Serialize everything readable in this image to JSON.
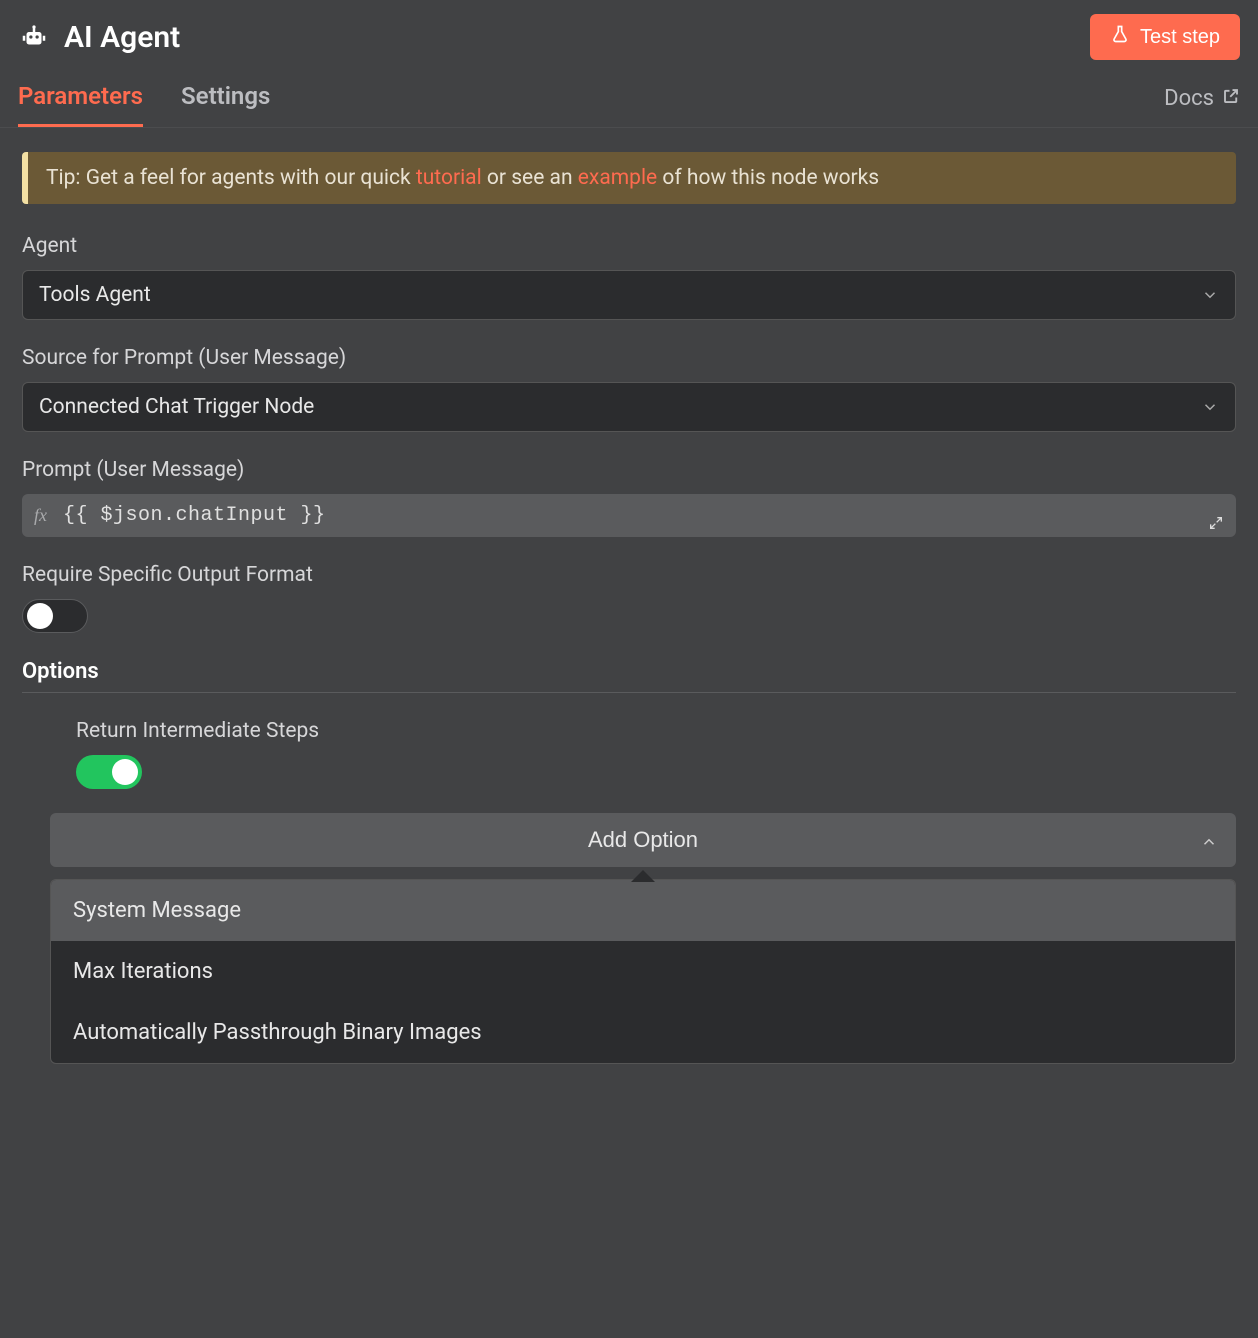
{
  "header": {
    "title": "AI Agent",
    "test_button": "Test step"
  },
  "tabs": {
    "parameters": "Parameters",
    "settings": "Settings",
    "docs": "Docs"
  },
  "tip": {
    "prefix": "Tip: Get a feel for agents with our quick ",
    "link1": "tutorial",
    "mid": " or see an ",
    "link2": "example",
    "suffix": " of how this node works"
  },
  "fields": {
    "agent": {
      "label": "Agent",
      "value": "Tools Agent"
    },
    "source_prompt": {
      "label": "Source for Prompt (User Message)",
      "value": "Connected Chat Trigger Node"
    },
    "prompt": {
      "label": "Prompt (User Message)",
      "value": "{{ $json.chatInput }}"
    },
    "require_format": {
      "label": "Require Specific Output Format"
    }
  },
  "options": {
    "heading": "Options",
    "return_intermediate": {
      "label": "Return Intermediate Steps"
    },
    "add_option": "Add Option",
    "menu": [
      "System Message",
      "Max Iterations",
      "Automatically Passthrough Binary Images"
    ]
  }
}
